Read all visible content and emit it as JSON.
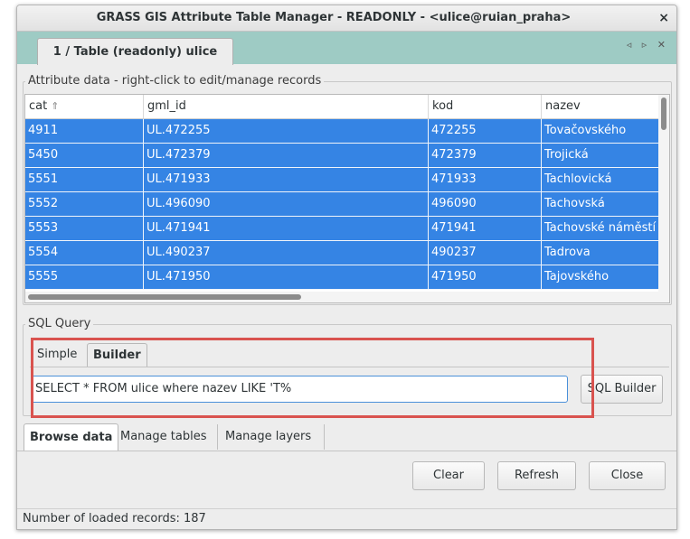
{
  "window": {
    "title": "GRASS GIS Attribute Table Manager - READONLY - <ulice@ruian_praha>",
    "close_glyph": "×"
  },
  "notebook": {
    "tab_label": "1 / Table (readonly) ulice",
    "nav_arrows": "◃ ▹ ✕"
  },
  "attribute_data": {
    "group_label": "Attribute data - right-click to edit/manage records",
    "columns": [
      "cat",
      "gml_id",
      "kod",
      "nazev"
    ],
    "sort_icon": "sort-ascending-icon",
    "rows": [
      [
        "4911",
        "UL.472255",
        "472255",
        "Tovačovského"
      ],
      [
        "5450",
        "UL.472379",
        "472379",
        "Trojická"
      ],
      [
        "5551",
        "UL.471933",
        "471933",
        "Tachlovická"
      ],
      [
        "5552",
        "UL.496090",
        "496090",
        "Tachovská"
      ],
      [
        "5553",
        "UL.471941",
        "471941",
        "Tachovské náměstí"
      ],
      [
        "5554",
        "UL.490237",
        "490237",
        "Tadrova"
      ],
      [
        "5555",
        "UL.471950",
        "471950",
        "Tajovského"
      ]
    ]
  },
  "sql_query": {
    "group_label": "SQL Query",
    "tabs": [
      "Simple",
      "Builder"
    ],
    "active_tab": "Builder",
    "input_value": "SELECT * FROM ulice where nazev LIKE 'T%",
    "builder_button": "SQL Builder"
  },
  "bottom_tabs": [
    "Browse data",
    "Manage tables",
    "Manage layers"
  ],
  "buttons": {
    "clear": "Clear",
    "refresh": "Refresh",
    "close": "Close"
  },
  "status": {
    "text": "Number of loaded records: 187"
  },
  "colors": {
    "selection": "#3584e4",
    "tab_strip": "#9ecbc4",
    "highlight_box": "#d9534f"
  }
}
